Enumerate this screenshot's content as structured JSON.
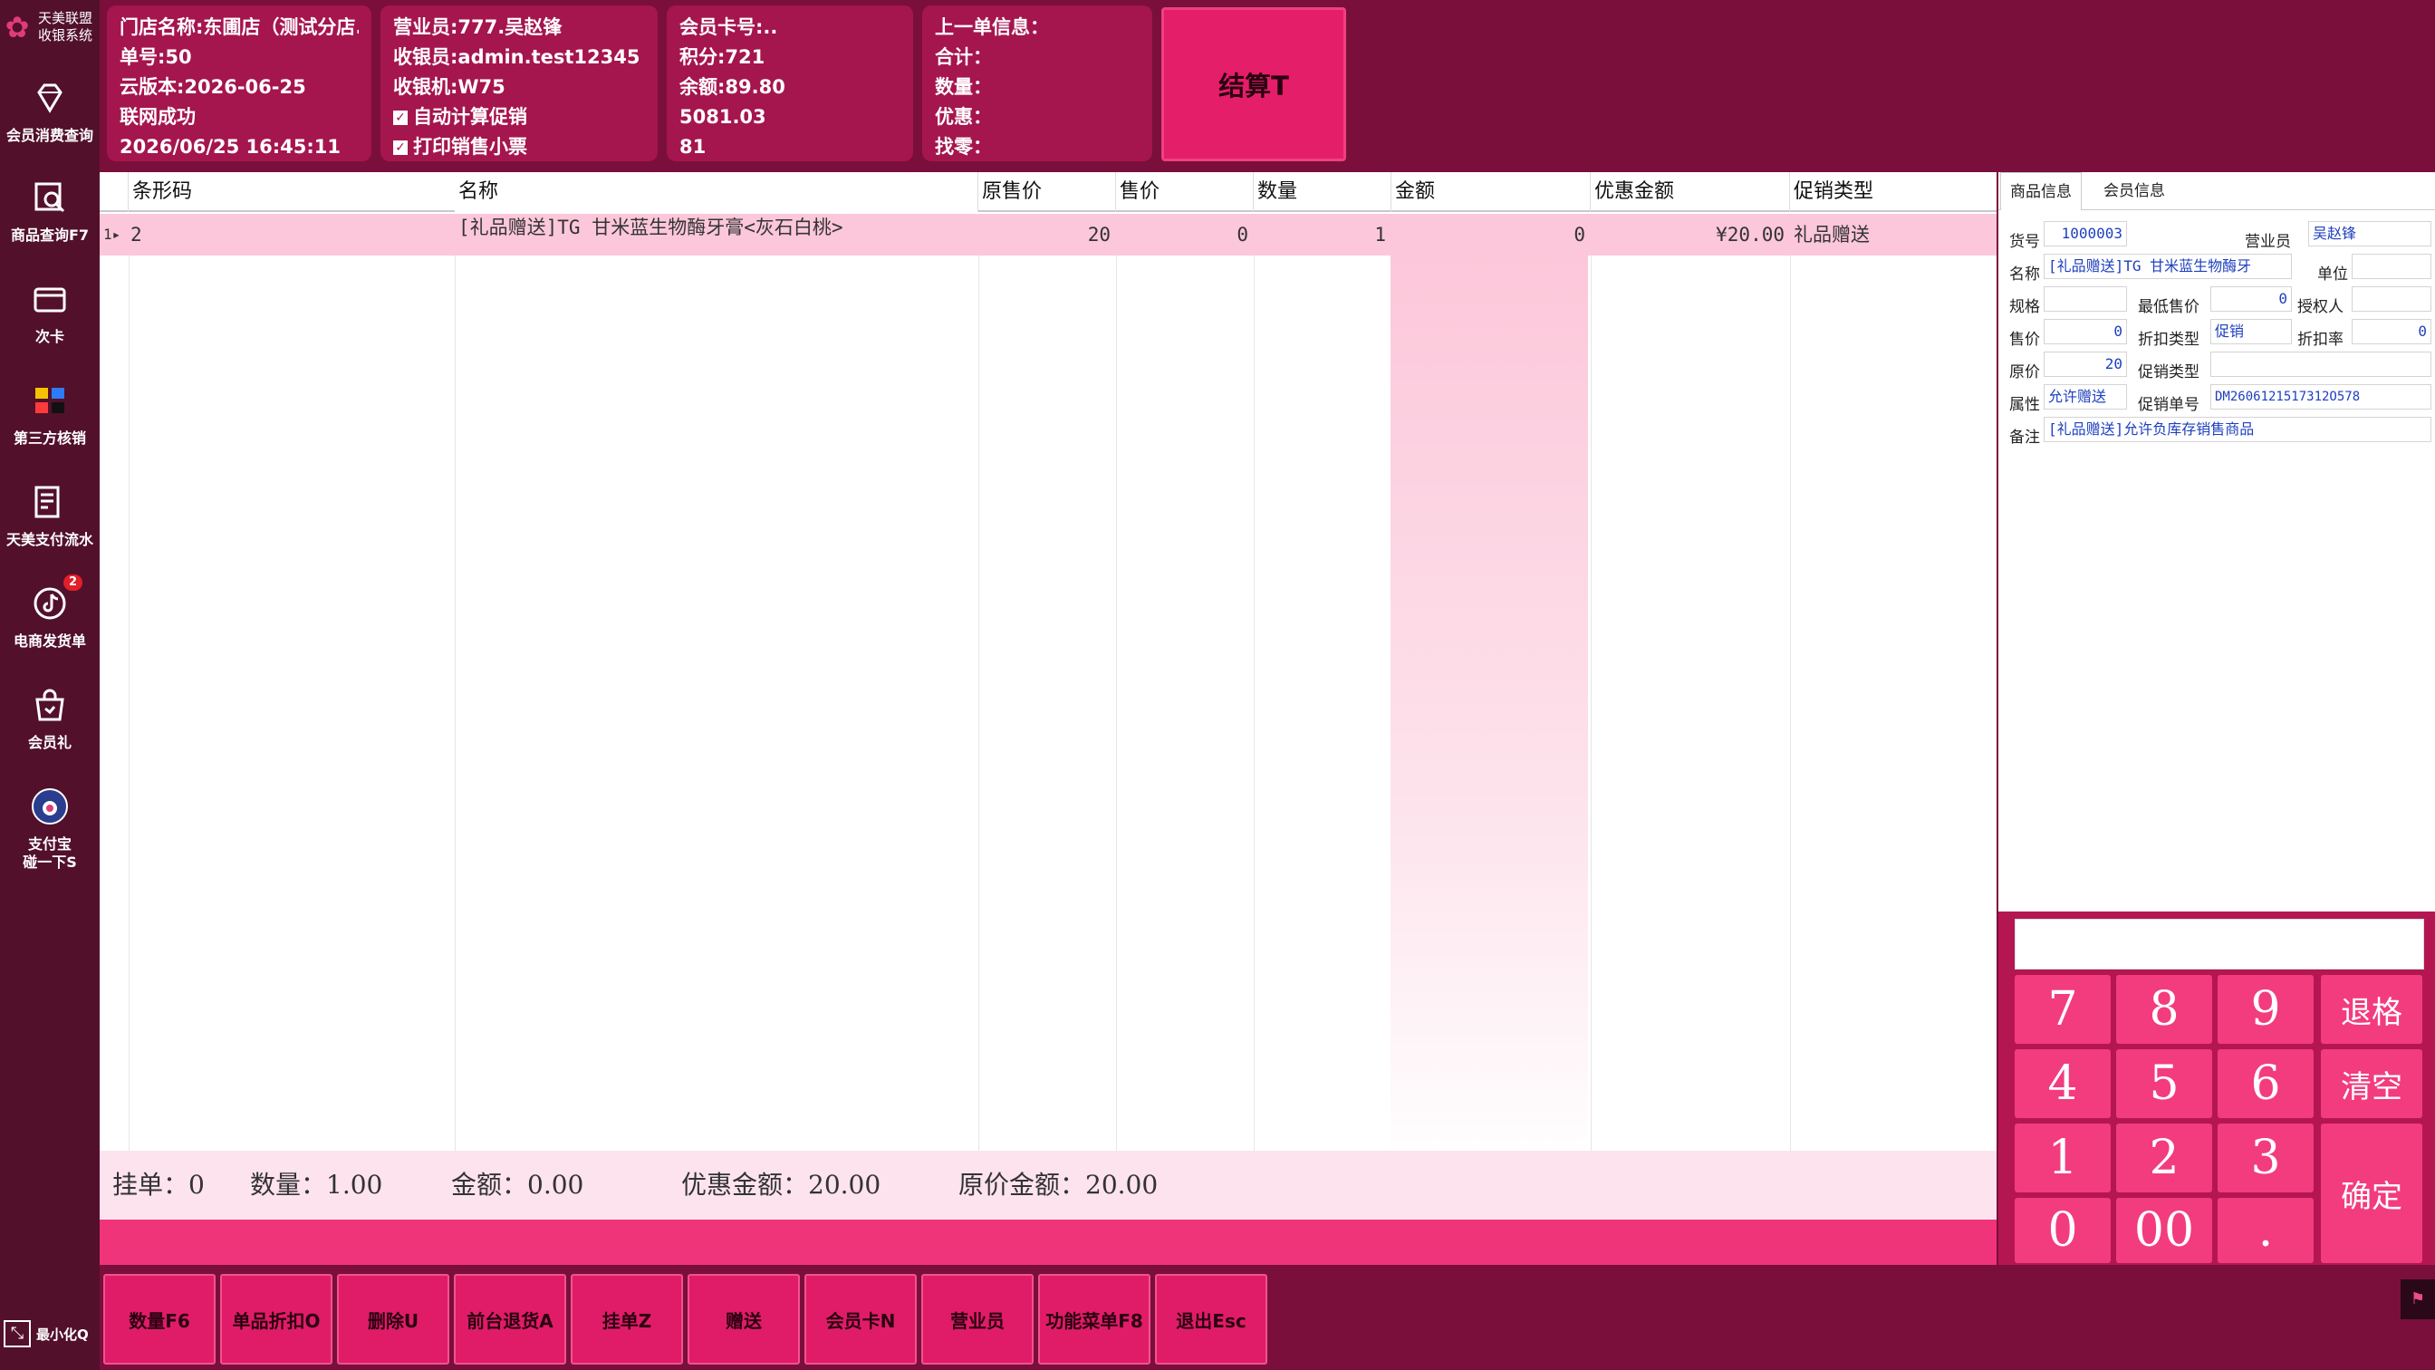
{
  "brand": {
    "line1": "天美联盟",
    "line2": "收银系统"
  },
  "sidebar": {
    "items": [
      {
        "label": "会员消费查询",
        "icon": "diamond-icon"
      },
      {
        "label": "商品查询F7",
        "icon": "product-search-icon"
      },
      {
        "label": "次卡",
        "icon": "card-icon"
      },
      {
        "label": "第三方核销",
        "icon": "third-party-icon"
      },
      {
        "label": "天美支付流水",
        "icon": "payment-list-icon"
      },
      {
        "label": "电商发货单",
        "icon": "tiktok-icon",
        "badge": "2"
      },
      {
        "label": "会员礼",
        "icon": "gift-bag-icon"
      },
      {
        "label": "支付宝\n碰一下S",
        "icon": "alipay-tap-icon"
      }
    ],
    "minimize_label": "最小化Q"
  },
  "store": {
    "name": "门店名称:东圃店（测试分店...",
    "order_no": "单号:50",
    "cloud_version": "云版本:2026-06-25",
    "network": "联网成功",
    "datetime": "2026/06/25 16:45:11"
  },
  "staff": {
    "salesperson": "营业员:777.吴赵锋",
    "cashier": "收银员:admin.test12345",
    "register": "收银机:W75",
    "auto_promo": "自动计算促销",
    "print_receipt": "打印销售小票"
  },
  "member": {
    "card_no": "会员卡号:..",
    "points": "积分:721",
    "balance": "余额:89.80",
    "value1": "5081.03",
    "value2": "81"
  },
  "last_order": {
    "title": "上一单信息：",
    "total": "合计：",
    "qty": "数量：",
    "discount": "优惠：",
    "change": "找零："
  },
  "checkout_label": "结算T",
  "grid": {
    "columns": [
      "条形码",
      "名称",
      "原售价",
      "售价",
      "数量",
      "金额",
      "优惠金额",
      "促销类型"
    ],
    "rows": [
      {
        "barcode": "2",
        "name": "[礼品赠送]TG 甘米蓝生物酶牙膏<灰石白桃>",
        "orig_price": "20",
        "price": "0",
        "qty": "1",
        "amount": "0",
        "discount_amount": "¥20.00",
        "promo_type": "礼品赠送"
      }
    ]
  },
  "totals": {
    "hold": "挂单：0",
    "qty": "数量：1.00",
    "amount": "金额：0.00",
    "discount": "优惠金额：20.00",
    "orig_amount": "原价金额：20.00"
  },
  "product_panel": {
    "tabs": [
      "商品信息",
      "会员信息"
    ],
    "labels": {
      "item_no": "货号",
      "salesperson": "营业员",
      "name": "名称",
      "unit": "单位",
      "spec": "规格",
      "min_price": "最低售价",
      "authorizer": "授权人",
      "price": "售价",
      "discount_type": "折扣类型",
      "discount_rate": "折扣率",
      "orig_price": "原价",
      "promo_type": "促销类型",
      "attribute": "属性",
      "promo_no": "促销单号",
      "remark": "备注"
    },
    "values": {
      "item_no": "1000003",
      "salesperson": "吴赵锋",
      "name": "[礼品赠送]TG 甘米蓝生物酶牙",
      "unit": "",
      "spec": "",
      "min_price": "0",
      "authorizer": "",
      "price": "0",
      "discount_type": "促销",
      "discount_rate": "0",
      "orig_price": "20",
      "promo_type": "",
      "attribute": "允许赠送",
      "promo_no": "DM2606121517312O578",
      "remark": "[礼品赠送]允许负库存销售商品"
    }
  },
  "keypad": {
    "keys": [
      "7",
      "8",
      "9",
      "4",
      "5",
      "6",
      "1",
      "2",
      "3",
      "0",
      "00",
      "."
    ],
    "backspace": "退格",
    "clear": "清空",
    "confirm": "确定"
  },
  "function_buttons": [
    "数量F6",
    "单品折扣O",
    "删除U",
    "前台退货A",
    "挂单Z",
    "赠送",
    "会员卡N",
    "营业员",
    "功能菜单F8",
    "退出Esc"
  ],
  "colors": {
    "header_bg": "#7a0f3c",
    "panel_bg": "#a5154e",
    "accent": "#f23c7d",
    "row_highlight": "#fcc7da"
  }
}
